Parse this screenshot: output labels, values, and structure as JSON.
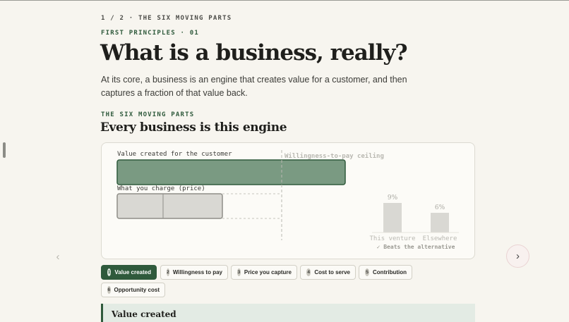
{
  "header": {
    "step": "1 / 2 · THE SIX MOVING PARTS",
    "section": "FIRST PRINCIPLES · 01",
    "title": "What is a business, really?",
    "lede": "At its core, a business is an engine that creates value for a customer, and then captures a fraction of that value back."
  },
  "engine": {
    "kicker": "THE SIX MOVING PARTS",
    "heading": "Every business is this engine"
  },
  "diagram": {
    "value_label": "Value created for the customer",
    "wtp_label": "Willingness-to-pay ceiling",
    "price_label": "What you charge (price)",
    "comparison": {
      "bars": [
        {
          "label": "This venture",
          "value": 9,
          "display": "9%"
        },
        {
          "label": "Elsewhere",
          "value": 6,
          "display": "6%"
        }
      ],
      "note": "✓ Beats the alternative"
    },
    "colors": {
      "value_fill": "#7a9a82",
      "value_stroke": "#2f5a3c",
      "price_fill": "#d9d8d3",
      "price_stroke": "#8f8e88",
      "muted": "#b9b8b1"
    }
  },
  "nav": {
    "prev_icon": "‹",
    "next_icon": "›"
  },
  "tabs": [
    {
      "num": "1",
      "label": "Value created",
      "active": true
    },
    {
      "num": "2",
      "label": "Willingness to pay",
      "active": false
    },
    {
      "num": "3",
      "label": "Price you capture",
      "active": false
    },
    {
      "num": "4",
      "label": "Cost to serve",
      "active": false
    },
    {
      "num": "5",
      "label": "Contribution",
      "active": false
    },
    {
      "num": "6",
      "label": "Opportunity cost",
      "active": false
    }
  ],
  "panel": {
    "title": "Value created"
  },
  "colors": {
    "accent": "#2f5a3c",
    "background": "#f7f5ef"
  }
}
